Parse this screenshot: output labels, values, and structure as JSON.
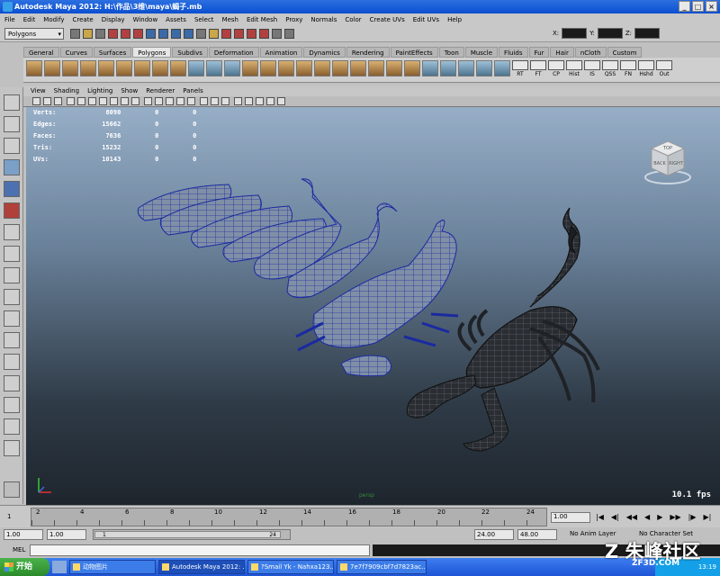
{
  "window": {
    "title": "Autodesk Maya 2012: H:\\作品\\3维\\maya\\蝎子.mb",
    "buttons": [
      "_",
      "□",
      "×"
    ]
  },
  "menus": [
    "File",
    "Edit",
    "Modify",
    "Create",
    "Display",
    "Window",
    "Assets",
    "Select",
    "Mesh",
    "Edit Mesh",
    "Proxy",
    "Normals",
    "Color",
    "Create UVs",
    "Edit UVs",
    "Help"
  ],
  "status": {
    "mode": "Polygons",
    "x_label": "X:",
    "y_label": "Y:",
    "z_label": "Z:"
  },
  "shelf_tabs": [
    "General",
    "Curves",
    "Surfaces",
    "Polygons",
    "Subdivs",
    "Deformation",
    "Animation",
    "Dynamics",
    "Rendering",
    "PaintEffects",
    "Toon",
    "Muscle",
    "Fluids",
    "Fur",
    "Hair",
    "nCloth",
    "Custom"
  ],
  "shelf_labels": [
    "RT",
    "FT",
    "CP",
    "Hist",
    "IS",
    "QSS",
    "FN",
    "Hshd",
    "Out"
  ],
  "panel_menus": [
    "View",
    "Shading",
    "Lighting",
    "Show",
    "Renderer",
    "Panels"
  ],
  "hud": {
    "rows": [
      {
        "label": "Verts:",
        "v1": "8090",
        "v2": "0",
        "v3": "0"
      },
      {
        "label": "Edges:",
        "v1": "15662",
        "v2": "0",
        "v3": "0"
      },
      {
        "label": "Faces:",
        "v1": "7636",
        "v2": "0",
        "v3": "0"
      },
      {
        "label": "Tris:",
        "v1": "15232",
        "v2": "0",
        "v3": "0"
      },
      {
        "label": "UVs:",
        "v1": "10143",
        "v2": "0",
        "v3": "0"
      }
    ],
    "fps": "10.1 fps",
    "camera": "persp",
    "cube_front": "RIGHT",
    "cube_side": "BACK",
    "cube_top": "TOP"
  },
  "timeline": {
    "ticks": [
      "2",
      "4",
      "6",
      "8",
      "10",
      "12",
      "14",
      "16",
      "18",
      "20",
      "22",
      "24"
    ],
    "current": "1",
    "end_field": "1.00"
  },
  "range": {
    "start": "1.00",
    "start2": "1.00",
    "slider_start": "1",
    "slider_end": "24",
    "end": "24.00",
    "end2": "48.00",
    "anim_layer": "No Anim Layer",
    "char_set": "No Character Set"
  },
  "mel": {
    "label": "MEL"
  },
  "taskbar": {
    "start": "开始",
    "tasks": [
      "动物图片",
      "Autodesk Maya 2012: ...",
      "?Smail Yk - Nahxa123....",
      "7e7f7909cbf7d7823ac..."
    ],
    "clock": "13:19"
  },
  "watermark": {
    "main": "朱峰社区",
    "sub": "ZF3D.COM"
  }
}
